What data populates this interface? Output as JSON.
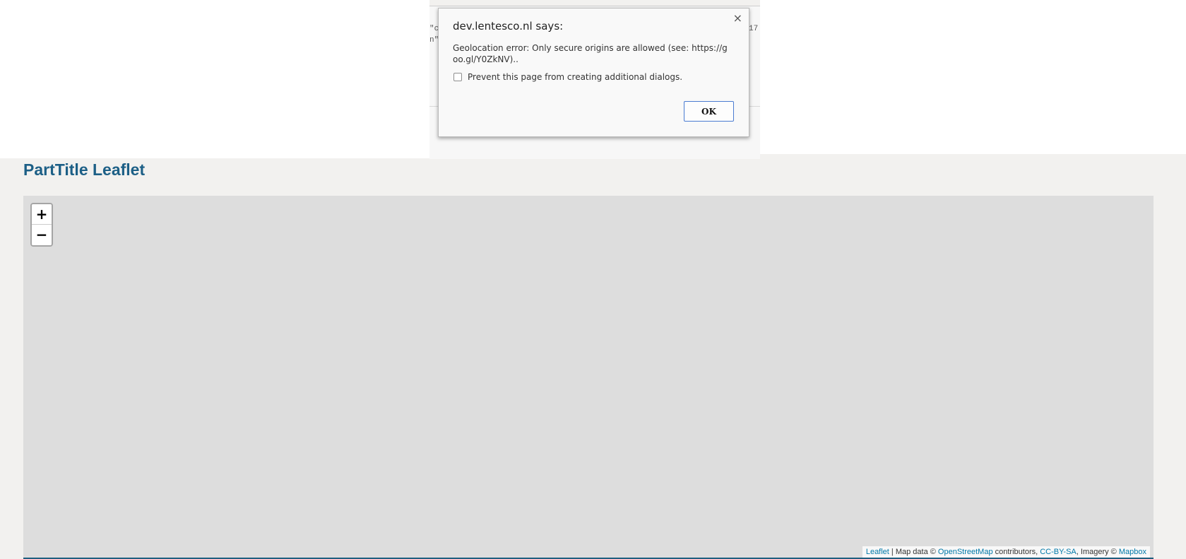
{
  "background_code": {
    "line1_left": "\"c",
    "line1_right": "17",
    "line2_left": "n\""
  },
  "dialog": {
    "title": "dev.lentesco.nl says:",
    "message": "Geolocation error: Only secure origins are allowed (see: https://goo.gl/Y0ZkNV)..",
    "checkbox_label": "Prevent this page from creating additional dialogs.",
    "ok_label": "OK",
    "close_glyph": "×"
  },
  "page": {
    "title": "PartTitle Leaflet"
  },
  "map": {
    "zoom_in_label": "+",
    "zoom_out_label": "−",
    "attribution": {
      "leaflet": "Leaflet",
      "sep1": " | Map data © ",
      "osm": "OpenStreetMap",
      "sep2": " contributors, ",
      "license": "CC-BY-SA",
      "sep3": ", Imagery © ",
      "mapbox": "Mapbox"
    }
  }
}
